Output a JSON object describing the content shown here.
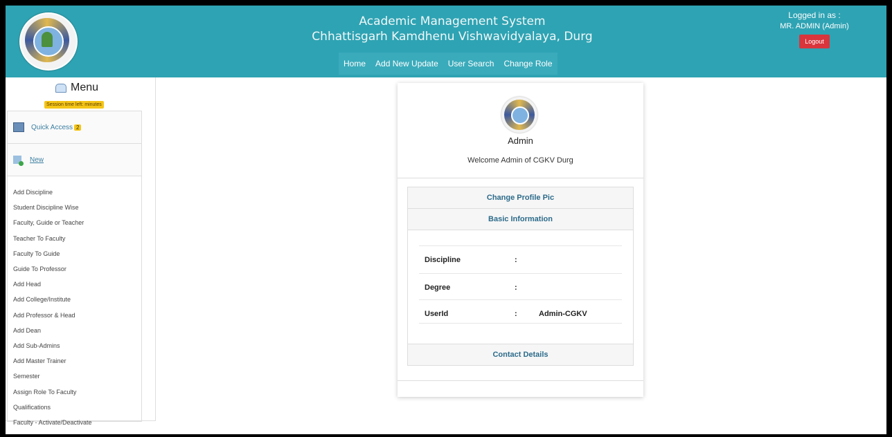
{
  "header": {
    "title_line1": "Academic Management System",
    "title_line2": "Chhattisgarh Kamdhenu Vishwavidyalaya, Durg",
    "nav": [
      {
        "label": "Home"
      },
      {
        "label": "Add New Update"
      },
      {
        "label": "User Search"
      },
      {
        "label": "Change Role"
      }
    ],
    "logged_in_as": "Logged in as :",
    "user": "MR. ADMIN (Admin)",
    "logout_label": "Logout"
  },
  "sidebar": {
    "menu_title": "Menu",
    "session_text": "Session time left: minutes",
    "quick_access_label": "Quick Access",
    "quick_access_count": "2",
    "new_label": "New",
    "items": [
      {
        "label": "Add Discipline"
      },
      {
        "label": "Student Discipline Wise"
      },
      {
        "label": "Faculty, Guide or Teacher"
      },
      {
        "label": "Teacher To Faculty"
      },
      {
        "label": "Faculty To Guide"
      },
      {
        "label": "Guide To Professor"
      },
      {
        "label": "Add Head"
      },
      {
        "label": "Add College/Institute"
      },
      {
        "label": "Add Professor & Head"
      },
      {
        "label": "Add Dean"
      },
      {
        "label": "Add Sub-Admins"
      },
      {
        "label": "Add Master Trainer"
      },
      {
        "label": "Semester"
      },
      {
        "label": "Assign Role To Faculty"
      },
      {
        "label": "Qualifications"
      },
      {
        "label": "Faculty - Activate/Deactivate"
      }
    ]
  },
  "profile": {
    "name": "Admin",
    "welcome": "Welcome Admin of CGKV Durg",
    "change_pic_label": "Change Profile Pic",
    "basic_info_label": "Basic Information",
    "fields": [
      {
        "label": "Discipline",
        "colon": ":",
        "value": ""
      },
      {
        "label": "Degree",
        "colon": ":",
        "value": ""
      },
      {
        "label": "UserId",
        "colon": ":",
        "value": "Admin-CGKV"
      }
    ],
    "contact_label": "Contact Details"
  },
  "colors": {
    "header_bg": "#2ea3b3",
    "logout_bg": "#d9353c",
    "badge_bg": "#f5c518",
    "section_text": "#2c6b8a"
  }
}
